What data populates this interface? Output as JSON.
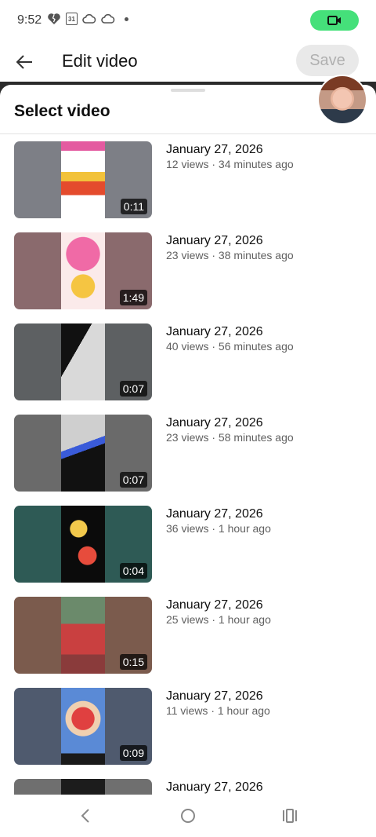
{
  "status": {
    "time": "9:52",
    "calendar_day": "31",
    "icons": [
      "heart-broken-icon",
      "calendar-icon",
      "cloud-icon",
      "cloud-icon",
      "dot-icon"
    ]
  },
  "appbar": {
    "title": "Edit video",
    "save_label": "Save"
  },
  "sheet": {
    "title": "Select video"
  },
  "videos": [
    {
      "date": "January 27, 2026",
      "meta": "12 views · 34 minutes ago",
      "duration": "0:11"
    },
    {
      "date": "January 27, 2026",
      "meta": "23 views · 38 minutes ago",
      "duration": "1:49"
    },
    {
      "date": "January 27, 2026",
      "meta": "40 views · 56 minutes ago",
      "duration": "0:07"
    },
    {
      "date": "January 27, 2026",
      "meta": "23 views · 58 minutes ago",
      "duration": "0:07"
    },
    {
      "date": "January 27, 2026",
      "meta": "36 views · 1 hour ago",
      "duration": "0:04"
    },
    {
      "date": "January 27, 2026",
      "meta": "25 views · 1 hour ago",
      "duration": "0:15"
    },
    {
      "date": "January 27, 2026",
      "meta": "11 views · 1 hour ago",
      "duration": "0:09"
    },
    {
      "date": "January 27, 2026",
      "meta": "",
      "duration": ""
    }
  ],
  "colors": {
    "accent_green": "#45e07a",
    "save_bg": "#e9e9e9",
    "save_text": "#b0b0b0"
  }
}
